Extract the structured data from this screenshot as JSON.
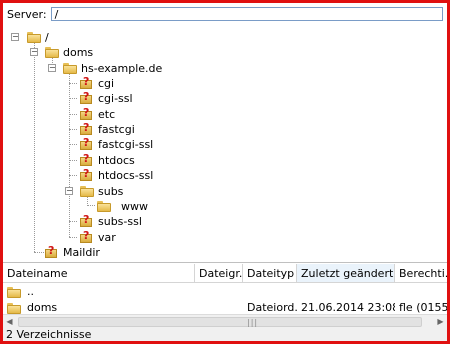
{
  "server": {
    "label": "Server:",
    "path": "/"
  },
  "tree": {
    "root": "/",
    "doms": "doms",
    "domain": "hs-example.de",
    "children": [
      "cgi",
      "cgi-ssl",
      "etc",
      "fastcgi",
      "fastcgi-ssl",
      "htdocs",
      "htdocs-ssl"
    ],
    "subs": "subs",
    "www": "www",
    "after_subs": [
      "subs-ssl",
      "var"
    ],
    "maildir": "Maildir"
  },
  "list": {
    "columns": [
      "Dateiname",
      "Dateigr...",
      "Dateityp",
      "Zuletzt geändert",
      "Berechti..."
    ],
    "sorted_column": "Zuletzt geändert",
    "rows": [
      {
        "name": "..",
        "size": "",
        "type": "",
        "modified": "",
        "perms": ""
      },
      {
        "name": "doms",
        "size": "",
        "type": "Dateiord...",
        "modified": "21.06.2014 23:08:...",
        "perms": "fle (0155..."
      }
    ]
  },
  "scrollbar": {
    "grip": "|||"
  },
  "status": {
    "text": "2 Verzeichnisse"
  },
  "colors": {
    "frame": "#e01010",
    "sorted_header": "#eaf3fb",
    "question_mark": "#d01515"
  }
}
